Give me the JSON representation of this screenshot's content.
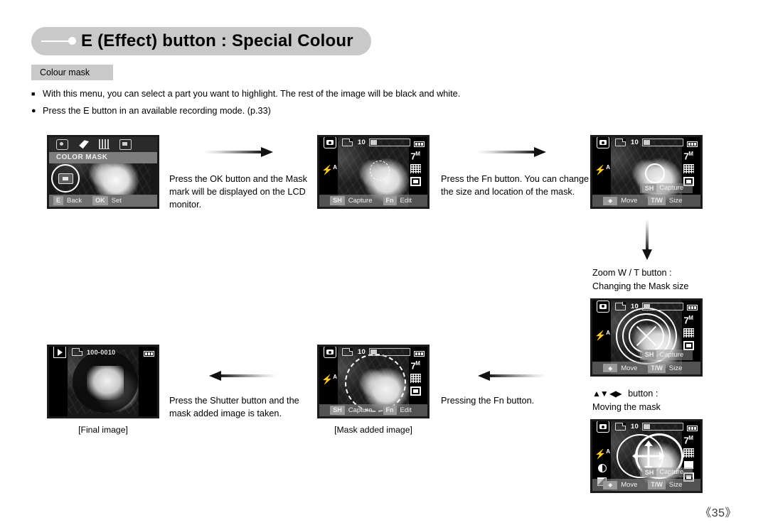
{
  "header": {
    "title": "E (Effect) button : Special Colour",
    "section_chip": "Colour mask",
    "bullets": [
      {
        "mark": "square",
        "text": "With this menu, you can select a part you want to highlight. The rest of the image will be black and white."
      },
      {
        "mark": "circle",
        "text": "Press the E button in an available recording mode. (p.33)"
      }
    ]
  },
  "steps": {
    "step1_caption": "Press the OK button and the Mask mark will be displayed on the LCD monitor.",
    "step2_caption": "Press the Fn button. You can change the size and location of the mask.",
    "step3_note_line1": "Zoom W / T button :",
    "step3_note_line2": "Changing the Mask size",
    "step4_note_arrows": "▲▼ ◀▶",
    "step4_note_label": "button :",
    "step4_note_line2": "Moving the mask",
    "step5_caption": "Pressing the Fn button.",
    "step6_caption": "Press the Shutter button and the mask added image is taken."
  },
  "captions": {
    "final_image": "[Final image]",
    "mask_added_image": "[Mask added image]"
  },
  "screens": {
    "menu": {
      "title": "COLOR MASK",
      "tabs": [
        "camera-tab-icon",
        "effect-tab-icon",
        "sound-tab-icon",
        "setup-tab-icon"
      ],
      "foot_keys": [
        {
          "chip": "E",
          "label": "Back"
        },
        {
          "chip": "OK",
          "label": "Set"
        }
      ]
    },
    "record": {
      "shots": "10",
      "resolution": "7",
      "resolution_sup": "M",
      "flash": "4",
      "flash_sup": "A",
      "keys_capture": [
        {
          "chip": "SH",
          "label": "Capture"
        },
        {
          "chip": "Fn",
          "label": "Edit"
        }
      ],
      "keys_move": [
        {
          "chip": "dpad",
          "label": "Move"
        },
        {
          "chip": "T/W",
          "label": "Size"
        }
      ],
      "floating_key": {
        "chip": "SH",
        "label": "Capture"
      }
    },
    "playback": {
      "file_no": "100-0010"
    }
  },
  "page_number": "《35》"
}
